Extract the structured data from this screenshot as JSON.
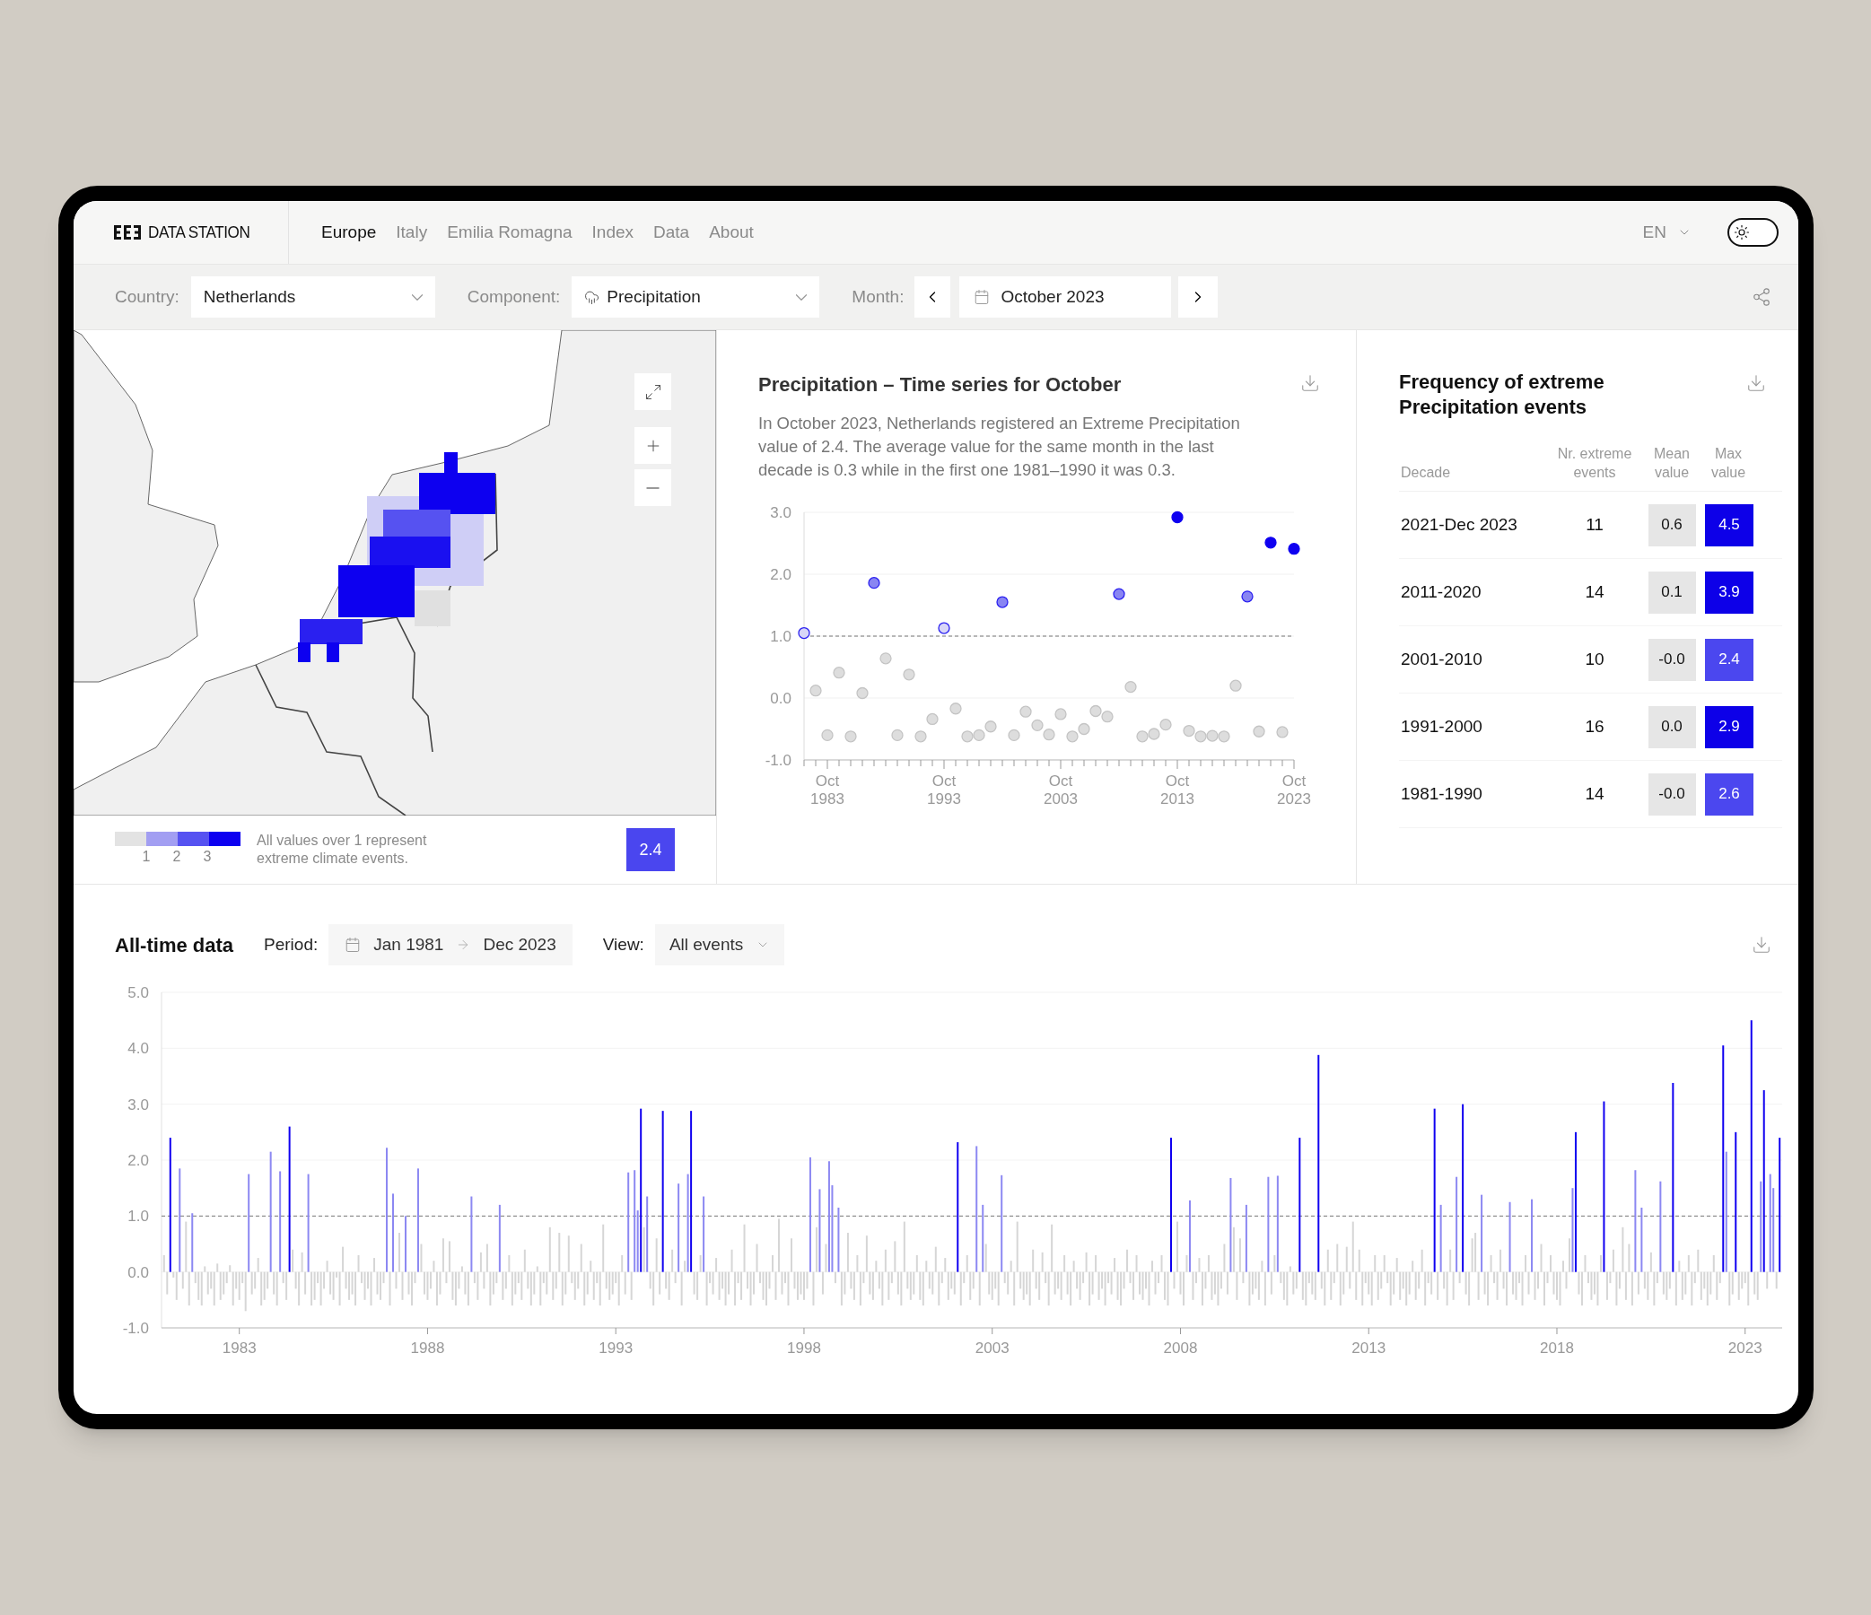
{
  "header": {
    "logo_text": "DATA STATION",
    "nav": [
      {
        "label": "Europe",
        "selected": true
      },
      {
        "label": "Italy",
        "selected": false
      },
      {
        "label": "Emilia Romagna",
        "selected": false
      },
      {
        "label": "Index",
        "selected": false
      },
      {
        "label": "Data",
        "selected": false
      },
      {
        "label": "About",
        "selected": false
      }
    ],
    "language": "EN",
    "theme_toggle": {
      "on": false
    }
  },
  "filters": {
    "country": {
      "label": "Country:",
      "value": "Netherlands"
    },
    "component": {
      "label": "Component:",
      "value": "Precipitation"
    },
    "month": {
      "label": "Month:",
      "value": "October 2023"
    }
  },
  "map": {
    "kind": "picture",
    "legend": {
      "swatches": [
        {
          "color": "#e3e3e3"
        },
        {
          "color": "#a29ef2"
        },
        {
          "color": "#5652f1"
        },
        {
          "color": "#0d00f0"
        }
      ],
      "scale_labels": [
        "1",
        "2",
        "3"
      ],
      "note": "All values over 1 represent extreme climate events.",
      "value": "2.4"
    }
  },
  "time_series": {
    "title": "Precipitation – Time series for October",
    "description": "In October 2023, Netherlands registered an Extreme Precipitation value of 2.4. The average value for the same month in the last decade is 0.3 while in the first one 1981–1990 it was 0.3.",
    "chart_data": {
      "type": "scatter",
      "categories": [
        null,
        null,
        "Oct 1983",
        null,
        null,
        null,
        null,
        null,
        null,
        null,
        null,
        null,
        "Oct 1993",
        null,
        null,
        null,
        null,
        null,
        null,
        null,
        null,
        null,
        "Oct 2003",
        null,
        null,
        null,
        null,
        null,
        null,
        null,
        null,
        null,
        "Oct 2013",
        null,
        null,
        null,
        null,
        null,
        null,
        null,
        null,
        null,
        "Oct 2023"
      ],
      "series": [
        {
          "values": [
            1.05,
            0.12,
            -0.6,
            0.41,
            -0.62,
            0.08,
            1.86,
            0.64,
            -0.6,
            0.38,
            -0.62,
            -0.34,
            1.13,
            -0.17,
            -0.62,
            -0.6,
            -0.46,
            1.55,
            -0.6,
            -0.22,
            -0.44,
            -0.59,
            -0.26,
            -0.62,
            -0.5,
            -0.21,
            -0.3,
            1.68,
            0.18,
            -0.62,
            -0.58,
            -0.43,
            2.92,
            -0.53,
            -0.62,
            -0.61,
            -0.62,
            0.2,
            1.64,
            -0.54,
            2.51,
            -0.55,
            2.41
          ]
        }
      ],
      "ylim": [
        -1,
        3
      ],
      "grid": true,
      "yticks": [
        {
          "value": 3,
          "label": "3.0"
        },
        {
          "value": 2,
          "label": "2.0"
        },
        {
          "value": 1,
          "label": "1.0"
        },
        {
          "value": 0,
          "label": "0.0"
        },
        {
          "value": -1,
          "label": "-1.0"
        }
      ],
      "ref_lines": [
        {
          "axis": "y",
          "value": 1
        }
      ]
    }
  },
  "frequency_table": {
    "title": "Frequency of extreme Precipitation events",
    "columns": [
      "Decade",
      "Nr. extreme events",
      "Mean value",
      "Max value"
    ],
    "rows": [
      {
        "decade": "2021-Dec 2023",
        "events": "11",
        "mean": "0.6",
        "max": "4.5",
        "color": "#0d00e8"
      },
      {
        "decade": "2011-2020",
        "events": "14",
        "mean": "0.1",
        "max": "3.9",
        "color": "#0d00e8"
      },
      {
        "decade": "2001-2010",
        "events": "10",
        "mean": "-0.0",
        "max": "2.4",
        "color": "#4b47ef"
      },
      {
        "decade": "1991-2000",
        "events": "16",
        "mean": "0.0",
        "max": "2.9",
        "color": "#0d00e8"
      },
      {
        "decade": "1981-1990",
        "events": "14",
        "mean": "-0.0",
        "max": "2.6",
        "color": "#4b47ef"
      }
    ]
  },
  "all_time": {
    "title": "All-time data",
    "period_label": "Period:",
    "period_from": "Jan 1981",
    "period_to": "Dec 2023",
    "view_label": "View:",
    "view_value": "All events",
    "chart_data": {
      "type": "bar",
      "categories": [
        null,
        null,
        null,
        null,
        null,
        null,
        null,
        null,
        null,
        null,
        null,
        null,
        null,
        null,
        null,
        null,
        null,
        null,
        null,
        null,
        null,
        null,
        null,
        null,
        "1983",
        null,
        null,
        null,
        null,
        null,
        null,
        null,
        null,
        null,
        null,
        null,
        null,
        null,
        null,
        null,
        null,
        null,
        null,
        null,
        null,
        null,
        null,
        null,
        null,
        null,
        null,
        null,
        null,
        null,
        null,
        null,
        null,
        null,
        null,
        null,
        null,
        null,
        null,
        null,
        null,
        null,
        null,
        null,
        null,
        null,
        null,
        null,
        null,
        null,
        null,
        null,
        null,
        null,
        null,
        null,
        null,
        null,
        null,
        null,
        "1988",
        null,
        null,
        null,
        null,
        null,
        null,
        null,
        null,
        null,
        null,
        null,
        null,
        null,
        null,
        null,
        null,
        null,
        null,
        null,
        null,
        null,
        null,
        null,
        null,
        null,
        null,
        null,
        null,
        null,
        null,
        null,
        null,
        null,
        null,
        null,
        null,
        null,
        null,
        null,
        null,
        null,
        null,
        null,
        null,
        null,
        null,
        null,
        null,
        null,
        null,
        null,
        null,
        null,
        null,
        null,
        null,
        null,
        null,
        null,
        "1993",
        null,
        null,
        null,
        null,
        null,
        null,
        null,
        null,
        null,
        null,
        null,
        null,
        null,
        null,
        null,
        null,
        null,
        null,
        null,
        null,
        null,
        null,
        null,
        null,
        null,
        null,
        null,
        null,
        null,
        null,
        null,
        null,
        null,
        null,
        null,
        null,
        null,
        null,
        null,
        null,
        null,
        null,
        null,
        null,
        null,
        null,
        null,
        null,
        null,
        null,
        null,
        null,
        null,
        null,
        null,
        null,
        null,
        null,
        null,
        "1998",
        null,
        null,
        null,
        null,
        null,
        null,
        null,
        null,
        null,
        null,
        null,
        null,
        null,
        null,
        null,
        null,
        null,
        null,
        null,
        null,
        null,
        null,
        null,
        null,
        null,
        null,
        null,
        null,
        null,
        null,
        null,
        null,
        null,
        null,
        null,
        null,
        null,
        null,
        null,
        null,
        null,
        null,
        null,
        null,
        null,
        null,
        null,
        null,
        null,
        null,
        null,
        null,
        null,
        null,
        null,
        null,
        null,
        null,
        null,
        "2003",
        null,
        null,
        null,
        null,
        null,
        null,
        null,
        null,
        null,
        null,
        null,
        null,
        null,
        null,
        null,
        null,
        null,
        null,
        null,
        null,
        null,
        null,
        null,
        null,
        null,
        null,
        null,
        null,
        null,
        null,
        null,
        null,
        null,
        null,
        null,
        null,
        null,
        null,
        null,
        null,
        null,
        null,
        null,
        null,
        null,
        null,
        null,
        null,
        null,
        null,
        null,
        null,
        null,
        null,
        null,
        null,
        null,
        null,
        null,
        "2008",
        null,
        null,
        null,
        null,
        null,
        null,
        null,
        null,
        null,
        null,
        null,
        null,
        null,
        null,
        null,
        null,
        null,
        null,
        null,
        null,
        null,
        null,
        null,
        null,
        null,
        null,
        null,
        null,
        null,
        null,
        null,
        null,
        null,
        null,
        null,
        null,
        null,
        null,
        null,
        null,
        null,
        null,
        null,
        null,
        null,
        null,
        null,
        null,
        null,
        null,
        null,
        null,
        null,
        null,
        null,
        null,
        null,
        null,
        null,
        "2013",
        null,
        null,
        null,
        null,
        null,
        null,
        null,
        null,
        null,
        null,
        null,
        null,
        null,
        null,
        null,
        null,
        null,
        null,
        null,
        null,
        null,
        null,
        null,
        null,
        null,
        null,
        null,
        null,
        null,
        null,
        null,
        null,
        null,
        null,
        null,
        null,
        null,
        null,
        null,
        null,
        null,
        null,
        null,
        null,
        null,
        null,
        null,
        null,
        null,
        null,
        null,
        null,
        null,
        null,
        null,
        null,
        null,
        null,
        null,
        "2018",
        null,
        null,
        null,
        null,
        null,
        null,
        null,
        null,
        null,
        null,
        null,
        null,
        null,
        null,
        null,
        null,
        null,
        null,
        null,
        null,
        null,
        null,
        null,
        null,
        null,
        null,
        null,
        null,
        null,
        null,
        null,
        null,
        null,
        null,
        null,
        null,
        null,
        null,
        null,
        null,
        null,
        null,
        null,
        null,
        null,
        null,
        null,
        null,
        null,
        null,
        null,
        null,
        null,
        null,
        null,
        null,
        null,
        null,
        null,
        "2023",
        null,
        null,
        null,
        null,
        null,
        null,
        null,
        null,
        null,
        null,
        null
      ],
      "series": [
        {
          "values": [
            0.3,
            -0.4,
            2.4,
            -0.1,
            -0.5,
            1.85,
            -0.3,
            0.9,
            -0.6,
            1.05,
            -0.2,
            -0.5,
            -0.6,
            0.1,
            -0.4,
            -0.3,
            -0.6,
            0.15,
            -0.5,
            -0.4,
            -0.2,
            0.12,
            -0.6,
            -0.3,
            -0.5,
            -0.2,
            -0.7,
            1.75,
            -0.4,
            -0.3,
            0.25,
            -0.6,
            -0.5,
            -0.3,
            2.15,
            -0.4,
            -0.6,
            1.8,
            -0.2,
            -0.5,
            2.6,
            0.4,
            -0.3,
            -0.6,
            0.35,
            -0.4,
            1.75,
            -0.6,
            -0.5,
            -0.2,
            -0.6,
            -0.3,
            0.2,
            -0.4,
            -0.5,
            -0.1,
            -0.6,
            0.45,
            -0.3,
            -0.5,
            -0.4,
            -0.6,
            0.3,
            -0.2,
            -0.5,
            -0.3,
            -0.6,
            0.25,
            -0.4,
            -0.5,
            -0.2,
            2.22,
            -0.6,
            1.4,
            -0.3,
            0.7,
            -0.5,
            1.0,
            -0.4,
            -0.6,
            -0.2,
            1.85,
            0.5,
            -0.4,
            -0.5,
            -0.3,
            0.2,
            -0.6,
            -0.4,
            0.6,
            -0.2,
            0.55,
            -0.5,
            -0.6,
            -0.3,
            0.1,
            -0.4,
            -0.6,
            1.35,
            -0.2,
            -0.5,
            0.35,
            -0.3,
            0.5,
            -0.6,
            -0.4,
            -0.2,
            1.2,
            -0.5,
            -0.3,
            0.3,
            -0.6,
            -0.4,
            -0.2,
            -0.5,
            0.4,
            -0.3,
            -0.6,
            -0.4,
            0.1,
            -0.6,
            -0.2,
            -0.4,
            0.8,
            -0.5,
            -0.3,
            0.7,
            -0.6,
            -0.4,
            0.65,
            -0.2,
            -0.5,
            -0.3,
            0.5,
            -0.6,
            -0.4,
            0.2,
            -0.5,
            -0.2,
            -0.6,
            0.85,
            -0.3,
            -0.5,
            -0.4,
            -0.2,
            -0.6,
            0.3,
            -0.4,
            1.78,
            -0.5,
            1.82,
            1.1,
            2.92,
            0.8,
            1.35,
            -0.3,
            -0.6,
            0.6,
            -0.4,
            2.88,
            -0.3,
            -0.5,
            0.4,
            -0.2,
            1.58,
            -0.6,
            0.2,
            1.75,
            2.88,
            -0.4,
            -0.5,
            0.3,
            1.35,
            -0.6,
            -0.2,
            -0.4,
            0.25,
            -0.5,
            -0.3,
            -0.6,
            -0.4,
            0.4,
            -0.6,
            -0.2,
            -0.5,
            0.85,
            -0.3,
            -0.6,
            -0.4,
            0.5,
            -0.2,
            -0.5,
            -0.6,
            -0.3,
            0.3,
            -0.5,
            0.95,
            -0.4,
            -0.2,
            -0.6,
            0.6,
            -0.3,
            -0.5,
            -0.4,
            -0.5,
            -0.3,
            2.05,
            -0.6,
            0.8,
            1.48,
            -0.4,
            0.5,
            1.98,
            1.55,
            -0.2,
            1.15,
            -0.6,
            -0.4,
            0.7,
            -0.3,
            -0.5,
            0.3,
            -0.6,
            -0.2,
            0.65,
            -0.4,
            -0.5,
            0.2,
            -0.3,
            -0.6,
            0.4,
            -0.5,
            -0.2,
            0.55,
            -0.4,
            -0.6,
            0.9,
            -0.3,
            -0.5,
            -0.4,
            0.3,
            -0.5,
            -0.6,
            0.2,
            -0.3,
            -0.4,
            0.45,
            -0.6,
            -0.2,
            0.25,
            -0.5,
            -0.3,
            -0.4,
            2.32,
            -0.6,
            -0.2,
            0.3,
            -0.5,
            -0.3,
            2.25,
            -0.6,
            1.2,
            0.5,
            -0.4,
            -0.5,
            -0.3,
            -0.6,
            1.73,
            -0.2,
            -0.4,
            0.2,
            -0.6,
            0.9,
            -0.3,
            -0.5,
            -0.4,
            -0.6,
            0.4,
            -0.3,
            -0.5,
            0.35,
            -0.2,
            -0.6,
            0.85,
            -0.4,
            -0.3,
            -0.5,
            0.3,
            -0.4,
            -0.6,
            0.2,
            -0.3,
            -0.5,
            -0.2,
            0.35,
            -0.6,
            -0.4,
            0.3,
            -0.5,
            -0.3,
            -0.6,
            -0.2,
            -0.4,
            0.25,
            -0.5,
            -0.6,
            -0.3,
            0.4,
            -0.2,
            -0.5,
            0.3,
            -0.4,
            -0.5,
            -0.3,
            -0.6,
            0.2,
            -0.4,
            -0.2,
            0.3,
            -0.5,
            -0.6,
            2.4,
            -0.3,
            0.9,
            -0.4,
            -0.6,
            0.3,
            1.28,
            -0.5,
            -0.2,
            0.25,
            -0.6,
            -0.3,
            0.3,
            -0.5,
            -0.4,
            -0.6,
            -0.3,
            0.5,
            -0.4,
            1.68,
            0.8,
            -0.5,
            0.6,
            -0.2,
            1.2,
            -0.6,
            -0.4,
            -0.3,
            -0.5,
            0.2,
            -0.6,
            1.7,
            -0.4,
            0.3,
            1.72,
            -0.2,
            -0.5,
            -0.6,
            0.1,
            -0.4,
            -0.3,
            2.4,
            -0.5,
            -0.6,
            -0.2,
            -0.4,
            -0.5,
            3.88,
            -0.3,
            -0.6,
            0.4,
            -0.5,
            -0.2,
            0.5,
            -0.6,
            -0.4,
            0.45,
            -0.3,
            0.9,
            -0.5,
            0.4,
            -0.6,
            -0.2,
            -0.4,
            -0.6,
            0.3,
            -0.5,
            -0.3,
            0.3,
            -0.2,
            -0.6,
            -0.4,
            0.25,
            -0.5,
            -0.3,
            -0.6,
            -0.4,
            0.2,
            -0.5,
            -0.3,
            0.4,
            -0.6,
            -0.2,
            -0.4,
            2.92,
            -0.5,
            1.2,
            -0.3,
            -0.6,
            0.4,
            -0.5,
            1.7,
            -0.2,
            3.0,
            -0.4,
            -0.6,
            0.6,
            0.7,
            -0.5,
            1.38,
            -0.4,
            -0.6,
            0.3,
            -0.2,
            -0.5,
            0.4,
            -0.3,
            -0.6,
            1.25,
            -0.4,
            -0.5,
            -0.2,
            -0.6,
            0.3,
            -0.4,
            1.3,
            -0.5,
            -0.3,
            0.5,
            -0.6,
            -0.2,
            0.3,
            -0.4,
            -0.5,
            -0.6,
            0.2,
            -0.3,
            0.6,
            1.5,
            2.5,
            -0.4,
            -0.6,
            0.3,
            -0.2,
            -0.5,
            -0.4,
            -0.6,
            0.3,
            3.05,
            -0.5,
            -0.2,
            0.4,
            -0.6,
            -0.3,
            0.8,
            -0.5,
            0.5,
            -0.6,
            1.82,
            -0.4,
            1.15,
            -0.3,
            -0.5,
            0.35,
            -0.6,
            -0.2,
            1.62,
            -0.4,
            -0.5,
            -0.3,
            3.38,
            -0.6,
            0.2,
            -0.5,
            -0.4,
            0.3,
            -0.6,
            -0.2,
            0.4,
            -0.5,
            -0.3,
            -0.6,
            -0.4,
            0.3,
            -0.5,
            -0.2,
            4.05,
            2.15,
            -0.6,
            -0.4,
            2.5,
            -0.5,
            -0.3,
            -0.2,
            -0.6,
            4.5,
            -0.4,
            -0.5,
            1.62,
            3.25,
            -0.3,
            1.75,
            1.5,
            -0.3,
            2.4
          ]
        }
      ],
      "ylim": [
        -1,
        5
      ],
      "grid": true,
      "yticks": [
        {
          "value": 5,
          "label": "5.0"
        },
        {
          "value": 4,
          "label": "4.0"
        },
        {
          "value": 3,
          "label": "3.0"
        },
        {
          "value": 2,
          "label": "2.0"
        },
        {
          "value": 1,
          "label": "1.0"
        },
        {
          "value": 0,
          "label": "0.0"
        },
        {
          "value": -1,
          "label": "-1.0"
        }
      ],
      "ref_lines": [
        {
          "axis": "y",
          "value": 1
        }
      ]
    }
  }
}
